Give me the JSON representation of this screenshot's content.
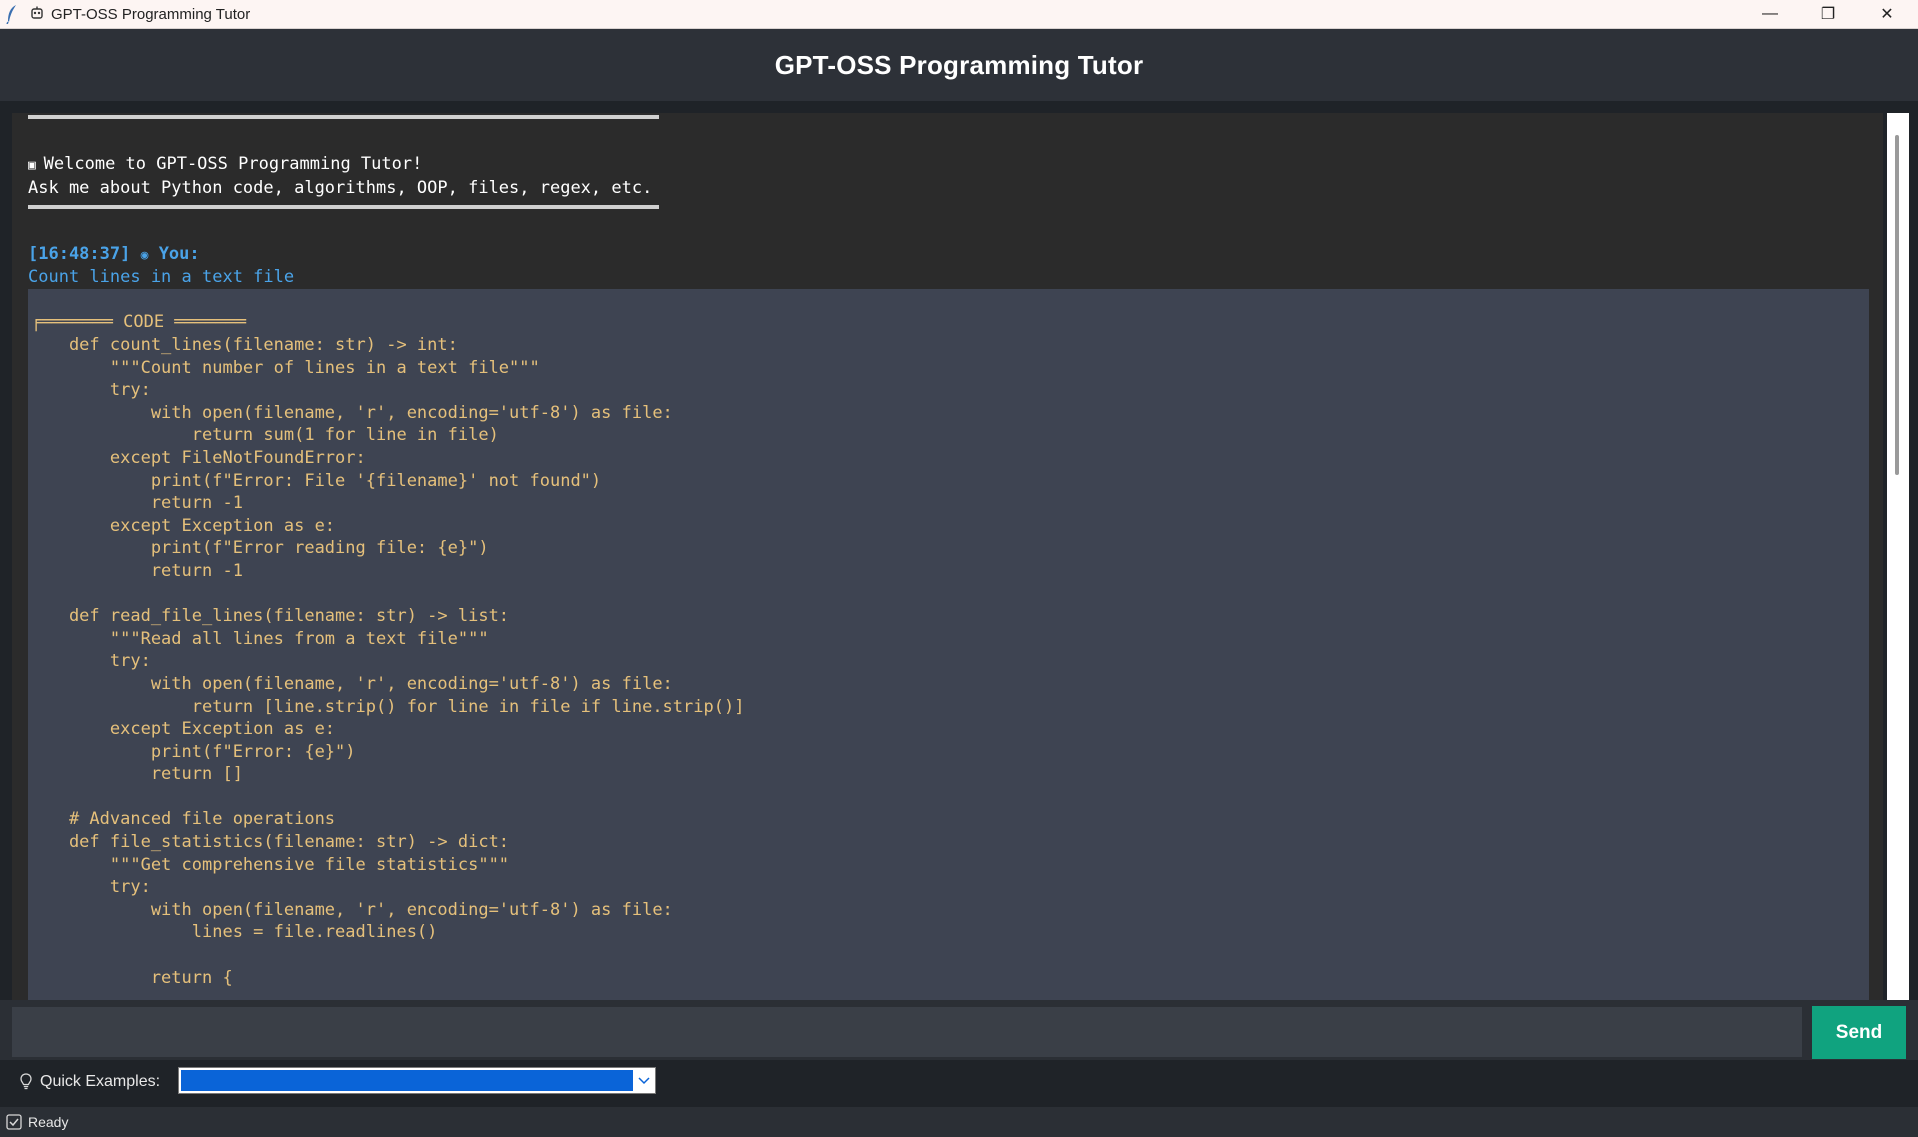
{
  "window": {
    "title": "GPT-OSS Programming Tutor",
    "controls": {
      "minimize": "—",
      "maximize": "❐",
      "close": "✕"
    }
  },
  "header": {
    "title": "GPT-OSS Programming Tutor"
  },
  "chat": {
    "welcome": {
      "line1": "Welcome to GPT-OSS Programming Tutor!",
      "line2": "Ask me about Python code, algorithms, OOP, files, regex, etc."
    },
    "user_message": {
      "timestamp": "[16:48:37]",
      "speaker": "You:",
      "text": "Count lines in a text file"
    },
    "code_block": {
      "header": "╒═══════ CODE ═══════",
      "lines": [
        "    def count_lines(filename: str) -> int:",
        "        \"\"\"Count number of lines in a text file\"\"\"",
        "        try:",
        "            with open(filename, 'r', encoding='utf-8') as file:",
        "                return sum(1 for line in file)",
        "        except FileNotFoundError:",
        "            print(f\"Error: File '{filename}' not found\")",
        "            return -1",
        "        except Exception as e:",
        "            print(f\"Error reading file: {e}\")",
        "            return -1",
        "",
        "    def read_file_lines(filename: str) -> list:",
        "        \"\"\"Read all lines from a text file\"\"\"",
        "        try:",
        "            with open(filename, 'r', encoding='utf-8') as file:",
        "                return [line.strip() for line in file if line.strip()]",
        "        except Exception as e:",
        "            print(f\"Error: {e}\")",
        "            return []",
        "",
        "    # Advanced file operations",
        "    def file_statistics(filename: str) -> dict:",
        "        \"\"\"Get comprehensive file statistics\"\"\"",
        "        try:",
        "            with open(filename, 'r', encoding='utf-8') as file:",
        "                lines = file.readlines()",
        "",
        "            return {"
      ]
    }
  },
  "input": {
    "value": "",
    "placeholder": "",
    "send_label": "Send"
  },
  "quick_examples": {
    "label": "Quick Examples:",
    "selected": ""
  },
  "status": {
    "text": "Ready"
  },
  "colors": {
    "accent": "#10a37f",
    "user": "#4aa3e8",
    "code_text": "#e5c07b",
    "code_bg": "#3e4452",
    "chat_bg": "#2b2b2b",
    "header_bg": "#2d3138",
    "select_highlight": "#0a64d8"
  }
}
